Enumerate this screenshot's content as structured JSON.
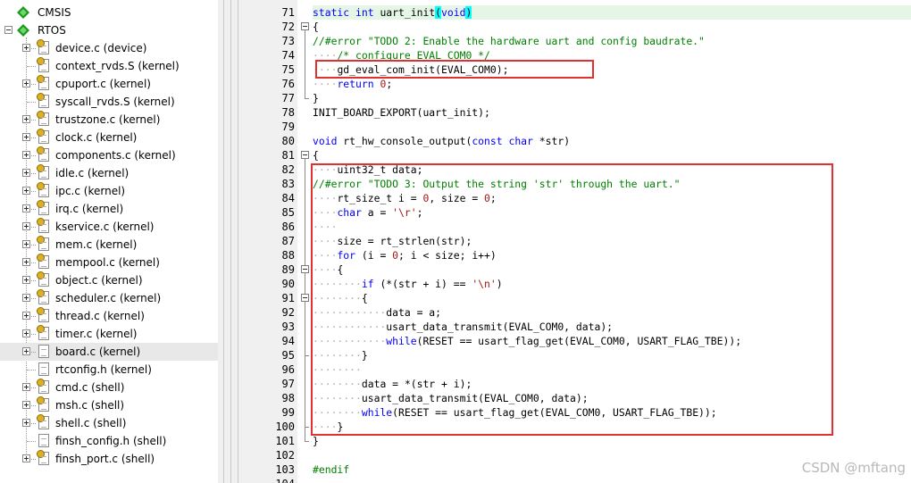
{
  "project_tree": {
    "groups": [
      {
        "label": "CMSIS"
      },
      {
        "label": "RTOS"
      }
    ],
    "files": [
      {
        "label": "device.c (device)"
      },
      {
        "label": "context_rvds.S (kernel)"
      },
      {
        "label": "cpuport.c (kernel)"
      },
      {
        "label": "syscall_rvds.S (kernel)"
      },
      {
        "label": "trustzone.c (kernel)"
      },
      {
        "label": "clock.c (kernel)"
      },
      {
        "label": "components.c (kernel)"
      },
      {
        "label": "idle.c (kernel)"
      },
      {
        "label": "ipc.c (kernel)"
      },
      {
        "label": "irq.c (kernel)"
      },
      {
        "label": "kservice.c (kernel)"
      },
      {
        "label": "mem.c (kernel)"
      },
      {
        "label": "mempool.c (kernel)"
      },
      {
        "label": "object.c (kernel)"
      },
      {
        "label": "scheduler.c (kernel)"
      },
      {
        "label": "thread.c (kernel)"
      },
      {
        "label": "timer.c (kernel)"
      },
      {
        "label": "board.c (kernel)"
      },
      {
        "label": "rtconfig.h (kernel)"
      },
      {
        "label": "cmd.c (shell)"
      },
      {
        "label": "msh.c (shell)"
      },
      {
        "label": "shell.c (shell)"
      },
      {
        "label": "finsh_config.h (shell)"
      },
      {
        "label": "finsh_port.c (shell)"
      }
    ],
    "selected": "board.c (kernel)"
  },
  "editor": {
    "lines": [
      {
        "n": "71",
        "html": "<span class=\"kw\">static</span> <span class=\"kw\">int</span> uart_init<span class=\"paren-hl\">(</span><span class=\"kw\">void</span><span class=\"paren-hl\">)</span>"
      },
      {
        "n": "72",
        "html": "{"
      },
      {
        "n": "73",
        "html": "<span class=\"cm\">//#error \"TODO 2: Enable the hardware uart and config baudrate.\"</span>"
      },
      {
        "n": "74",
        "html": "    <span class=\"cm\">/* configure EVAL_COM0 */</span>"
      },
      {
        "n": "75",
        "html": "    gd_eval_com_init(EVAL_COM0);"
      },
      {
        "n": "76",
        "html": "    <span class=\"kw\">return</span> <span class=\"num\">0</span>;"
      },
      {
        "n": "77",
        "html": "}"
      },
      {
        "n": "78",
        "html": "INIT_BOARD_EXPORT(uart_init);"
      },
      {
        "n": "79",
        "html": ""
      },
      {
        "n": "80",
        "html": "<span class=\"kw\">void</span> rt_hw_console_output(<span class=\"kw\">const</span> <span class=\"kw\">char</span> *str)"
      },
      {
        "n": "81",
        "html": "{"
      },
      {
        "n": "82",
        "html": "    uint32_t data;"
      },
      {
        "n": "83",
        "html": "<span class=\"cm\">//#error \"TODO 3: Output the string 'str' through the uart.\"</span>"
      },
      {
        "n": "84",
        "html": "    rt_size_t i = <span class=\"num\">0</span>, size = <span class=\"num\">0</span>;"
      },
      {
        "n": "85",
        "html": "    <span class=\"kw\">char</span> a = <span class=\"st\">'\\r'</span>;"
      },
      {
        "n": "86",
        "html": "    "
      },
      {
        "n": "87",
        "html": "    size = rt_strlen(str);"
      },
      {
        "n": "88",
        "html": "    <span class=\"kw\">for</span> (i = <span class=\"num\">0</span>; i &lt; size; i++)"
      },
      {
        "n": "89",
        "html": "    {"
      },
      {
        "n": "90",
        "html": "        <span class=\"kw\">if</span> (*(str + i) == <span class=\"st\">'\\n'</span>)"
      },
      {
        "n": "91",
        "html": "        {"
      },
      {
        "n": "92",
        "html": "            data = a;"
      },
      {
        "n": "93",
        "html": "            usart_data_transmit(EVAL_COM0, data);"
      },
      {
        "n": "94",
        "html": "            <span class=\"kw\">while</span>(RESET == usart_flag_get(EVAL_COM0, USART_FLAG_TBE));"
      },
      {
        "n": "95",
        "html": "        }"
      },
      {
        "n": "96",
        "html": "        "
      },
      {
        "n": "97",
        "html": "        data = *(str + i);"
      },
      {
        "n": "98",
        "html": "        usart_data_transmit(EVAL_COM0, data);"
      },
      {
        "n": "99",
        "html": "        <span class=\"kw\">while</span>(RESET == usart_flag_get(EVAL_COM0, USART_FLAG_TBE));"
      },
      {
        "n": "100",
        "html": "    }"
      },
      {
        "n": "101",
        "html": "}"
      },
      {
        "n": "102",
        "html": ""
      },
      {
        "n": "103",
        "html": "<span class=\"cm\">#endif</span>"
      },
      {
        "n": "104",
        "html": ""
      }
    ]
  },
  "watermark": "CSDN @mftang",
  "colors": {
    "keyword": "#0000ff",
    "comment": "#008000",
    "string": "#a31515",
    "highlight_line": "#e6f6e6",
    "annotation_box": "#e03030",
    "group_icon": "#1a9a1a"
  }
}
